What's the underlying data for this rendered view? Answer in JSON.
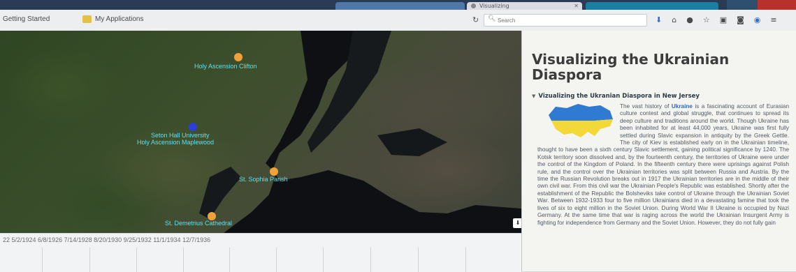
{
  "browser": {
    "bookmarks": [
      "Getting Started",
      "My Applications"
    ],
    "tab_active_title": "Visualizing",
    "search_placeholder": "Search"
  },
  "map": {
    "places": [
      {
        "name": "Holy Ascension Clifton"
      },
      {
        "name": "Seton Hall University"
      },
      {
        "name": "Holy Ascension Maplewood"
      },
      {
        "name": "St. Sophia Parish"
      },
      {
        "name": "St. Demetrius Cathedral"
      }
    ]
  },
  "timeline": {
    "dates_text": "22 5/2/1924   6/8/1926 7/14/1928 8/20/1930 9/25/1932 11/1/1934 12/7/1936"
  },
  "sidebar": {
    "title": "Visualizing the Ukrainian Diaspora",
    "section_heading": "Vizualizing the Ukranian Diaspora in New Jersey",
    "body_before": "The vast history of ",
    "body_highlight": "Ukraine",
    "body_after": " is a fascinating account of Eurasian culture contest and global struggle, that continues to spread its deep culture and traditions around the world. Though Ukraine has been inhabited for at least 44,000 years, Ukraine was first fully settled during Slavic expansion in antiquity by the Greek Gettle. The city of Kiev is established early on in the Ukrainian timeline, thought to have been a sixth century Slavic settlement, gaining political significance by 1240. The Kotsk territory soon dissolved and, by the fourteenth century, the territories of Ukraine were under the control of the Kingdom of Poland. In the fifteenth century there were uprisings against Polish rule, and the control over the Ukrainian territories was split between Russia and Austria. By the time the Russian Revolution breaks out in 1917 the Ukrainian territories are in the middle of their own civil war. From this civil war the Ukrainian People's Republic was established. Shortly after the establishment of the Republic the Bolsheviks take control of Ukraine through the Ukrainian Soviet War. Between 1932-1933 four to five million Ukrainians died in a devastating famine that took the lives of six to eight million in the Soviet Union. During World War II Ukraine is occupied by Nazi Germany. At the same time that war is raging across the world the Ukrainian Insurgent Army is fighting for independence from Germany and the Soviet Union. However, they do not fully gain"
  },
  "colors": {
    "marker": "#f0a23a",
    "marker_selected": "#2b3fd6",
    "label": "#5ee3f0",
    "flag_blue": "#2f7bd1",
    "flag_yellow": "#f3d83a"
  }
}
